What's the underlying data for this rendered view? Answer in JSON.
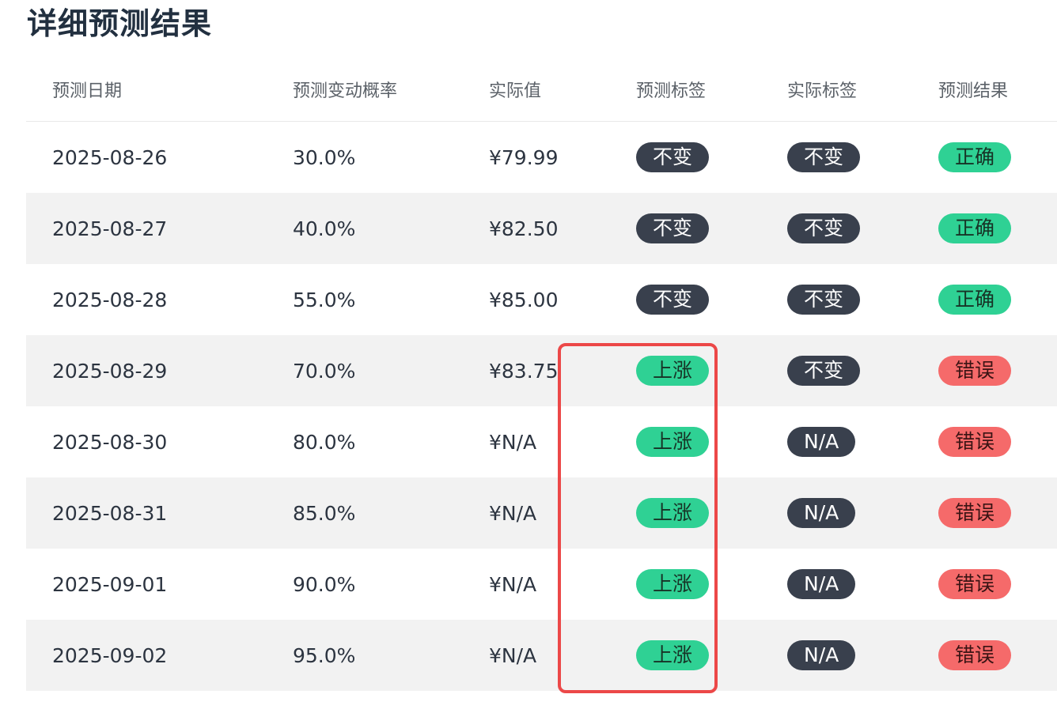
{
  "title": "详细预测结果",
  "columns": [
    "预测日期",
    "预测变动概率",
    "实际值",
    "预测标签",
    "实际标签",
    "预测结果"
  ],
  "colors": {
    "dark_badge": "#39404d",
    "green_badge": "#2fd194",
    "red_badge": "#f56a6a",
    "highlight_border": "#ec4848",
    "stripe": "#f2f2f2"
  },
  "rows": [
    {
      "date": "2025-08-26",
      "prob": "30.0%",
      "actual": "¥79.99",
      "pred_label": "不变",
      "pred_style": "dark",
      "actual_label": "不变",
      "actual_style": "dark",
      "result": "正确",
      "result_style": "green"
    },
    {
      "date": "2025-08-27",
      "prob": "40.0%",
      "actual": "¥82.50",
      "pred_label": "不变",
      "pred_style": "dark",
      "actual_label": "不变",
      "actual_style": "dark",
      "result": "正确",
      "result_style": "green"
    },
    {
      "date": "2025-08-28",
      "prob": "55.0%",
      "actual": "¥85.00",
      "pred_label": "不变",
      "pred_style": "dark",
      "actual_label": "不变",
      "actual_style": "dark",
      "result": "正确",
      "result_style": "green"
    },
    {
      "date": "2025-08-29",
      "prob": "70.0%",
      "actual": "¥83.75",
      "pred_label": "上涨",
      "pred_style": "green",
      "actual_label": "不变",
      "actual_style": "dark",
      "result": "错误",
      "result_style": "red"
    },
    {
      "date": "2025-08-30",
      "prob": "80.0%",
      "actual": "¥N/A",
      "pred_label": "上涨",
      "pred_style": "green",
      "actual_label": "N/A",
      "actual_style": "dark",
      "result": "错误",
      "result_style": "red"
    },
    {
      "date": "2025-08-31",
      "prob": "85.0%",
      "actual": "¥N/A",
      "pred_label": "上涨",
      "pred_style": "green",
      "actual_label": "N/A",
      "actual_style": "dark",
      "result": "错误",
      "result_style": "red"
    },
    {
      "date": "2025-09-01",
      "prob": "90.0%",
      "actual": "¥N/A",
      "pred_label": "上涨",
      "pred_style": "green",
      "actual_label": "N/A",
      "actual_style": "dark",
      "result": "错误",
      "result_style": "red"
    },
    {
      "date": "2025-09-02",
      "prob": "95.0%",
      "actual": "¥N/A",
      "pred_label": "上涨",
      "pred_style": "green",
      "actual_label": "N/A",
      "actual_style": "dark",
      "result": "错误",
      "result_style": "red"
    }
  ]
}
